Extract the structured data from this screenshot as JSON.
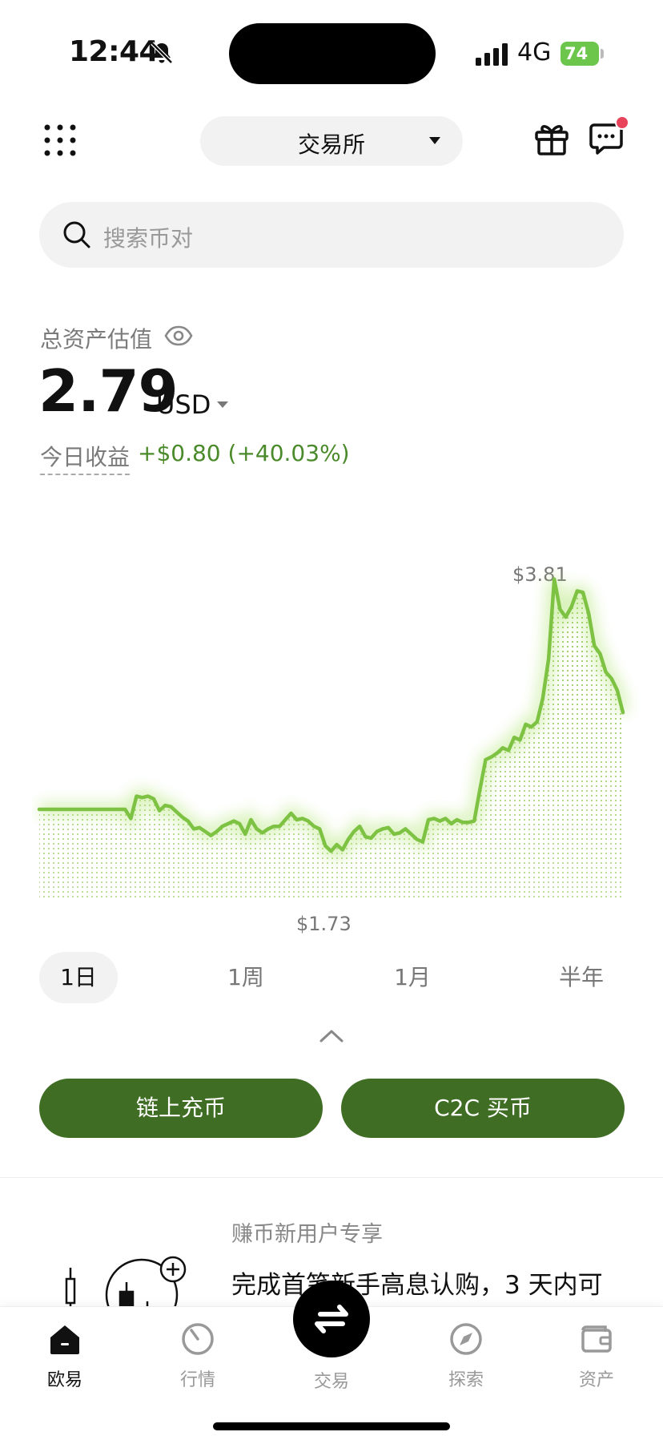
{
  "status_bar": {
    "time": "12:44",
    "network": "4G",
    "battery": "74"
  },
  "header": {
    "exchange_label": "交易所"
  },
  "search": {
    "placeholder": "搜索币对"
  },
  "balance": {
    "label": "总资产估值",
    "value": "2.79",
    "currency": "USD",
    "pnl_label": "今日收益",
    "pnl_value": "+$0.80 (+40.03%)"
  },
  "chart_data": {
    "type": "area",
    "x_label": "",
    "y_label": "",
    "high_label": "$3.81",
    "low_label": "$1.73",
    "ylim": [
      1.4,
      3.95
    ],
    "line_color": "#7dc242",
    "values": [
      2.05,
      2.05,
      2.05,
      2.05,
      2.05,
      2.05,
      2.05,
      2.05,
      2.05,
      2.05,
      2.05,
      2.05,
      2.05,
      2.05,
      2.05,
      2.05,
      1.98,
      2.15,
      2.14,
      2.15,
      2.13,
      2.04,
      2.08,
      2.07,
      2.03,
      1.99,
      1.96,
      1.9,
      1.91,
      1.88,
      1.85,
      1.88,
      1.92,
      1.94,
      1.96,
      1.94,
      1.86,
      1.97,
      1.9,
      1.87,
      1.9,
      1.92,
      1.92,
      1.97,
      2.02,
      1.97,
      1.98,
      1.96,
      1.92,
      1.9,
      1.77,
      1.73,
      1.78,
      1.74,
      1.82,
      1.88,
      1.92,
      1.84,
      1.83,
      1.88,
      1.9,
      1.91,
      1.86,
      1.87,
      1.9,
      1.86,
      1.82,
      1.8,
      1.97,
      1.98,
      1.96,
      1.98,
      1.94,
      1.97,
      1.95,
      1.95,
      1.96,
      2.2,
      2.43,
      2.45,
      2.48,
      2.52,
      2.5,
      2.6,
      2.58,
      2.7,
      2.68,
      2.72,
      2.9,
      3.2,
      3.81,
      3.58,
      3.52,
      3.6,
      3.72,
      3.71,
      3.55,
      3.3,
      3.24,
      3.1,
      3.05,
      2.96,
      2.79
    ]
  },
  "ranges": [
    "1日",
    "1周",
    "1月",
    "半年"
  ],
  "active_range": "1日",
  "actions": {
    "deposit": "链上充币",
    "c2c": "C2C 买币"
  },
  "promo": {
    "subtitle": "赚币新用户专享",
    "title": "完成首笔新手高息认购，3 天内可"
  },
  "nav": {
    "home": "欧易",
    "markets": "行情",
    "trade": "交易",
    "discover": "探索",
    "assets": "资产"
  }
}
